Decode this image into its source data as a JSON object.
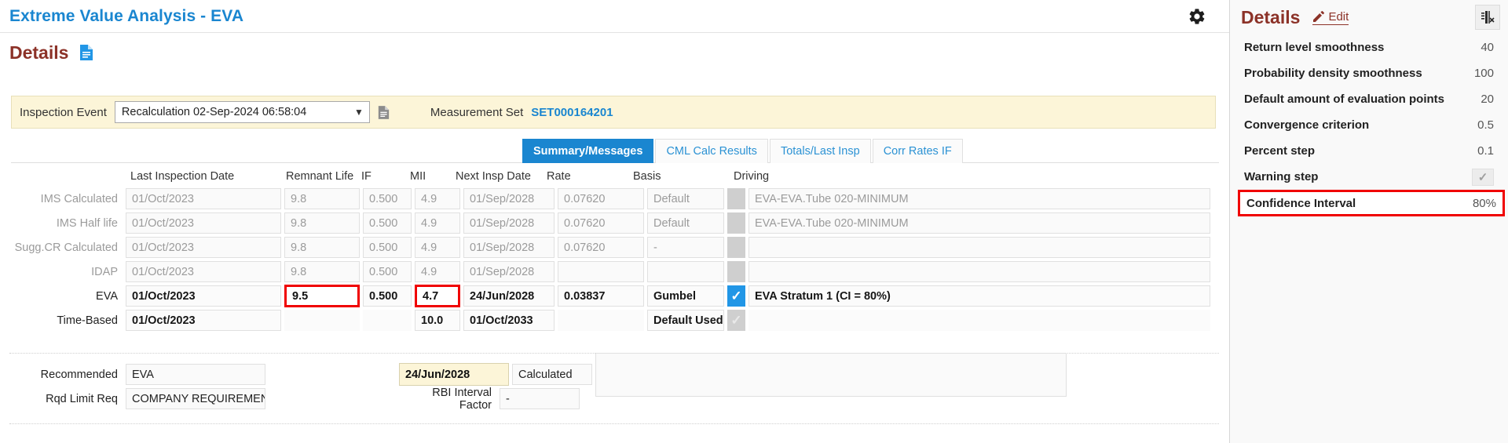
{
  "app": {
    "title": "Extreme Value Analysis - EVA",
    "gear_icon": "gear-icon"
  },
  "section": {
    "title": "Details",
    "doc_icon": "document-icon"
  },
  "eventbar": {
    "inspection_event_label": "Inspection Event",
    "inspection_event_value": "Recalculation 02-Sep-2024 06:58:04",
    "event_doc_icon": "document-icon",
    "measurement_set_label": "Measurement Set",
    "measurement_set_value": "SET000164201"
  },
  "tabs": [
    {
      "label": "Summary/Messages",
      "active": true
    },
    {
      "label": "CML Calc Results",
      "active": false
    },
    {
      "label": "Totals/Last Insp",
      "active": false
    },
    {
      "label": "Corr Rates IF",
      "active": false
    }
  ],
  "grid": {
    "headers": {
      "last_inspection_date": "Last Inspection Date",
      "remnant_life": "Remnant Life",
      "if": "IF",
      "mii": "MII",
      "next_insp_date": "Next Insp Date",
      "rate": "Rate",
      "basis": "Basis",
      "driving": "Driving"
    },
    "rows": [
      {
        "label": "IMS Calculated",
        "last_inspection_date": "01/Oct/2023",
        "remnant_life": "9.8",
        "if": "0.500",
        "mii": "4.9",
        "next_insp_date": "01/Sep/2028",
        "rate": "0.07620",
        "basis": "Default",
        "check": "empty",
        "driving": "EVA-EVA.Tube 020-MINIMUM"
      },
      {
        "label": "IMS Half life",
        "last_inspection_date": "01/Oct/2023",
        "remnant_life": "9.8",
        "if": "0.500",
        "mii": "4.9",
        "next_insp_date": "01/Sep/2028",
        "rate": "0.07620",
        "basis": "Default",
        "check": "empty",
        "driving": "EVA-EVA.Tube 020-MINIMUM"
      },
      {
        "label": "Sugg.CR Calculated",
        "last_inspection_date": "01/Oct/2023",
        "remnant_life": "9.8",
        "if": "0.500",
        "mii": "4.9",
        "next_insp_date": "01/Sep/2028",
        "rate": "0.07620",
        "basis": "-",
        "check": "empty",
        "driving": ""
      },
      {
        "label": "IDAP",
        "last_inspection_date": "01/Oct/2023",
        "remnant_life": "9.8",
        "if": "0.500",
        "mii": "4.9",
        "next_insp_date": "01/Sep/2028",
        "rate": "",
        "basis": "",
        "check": "empty",
        "driving": ""
      },
      {
        "label": "EVA",
        "last_inspection_date": "01/Oct/2023",
        "remnant_life": "9.5",
        "if": "0.500",
        "mii": "4.7",
        "next_insp_date": "24/Jun/2028",
        "rate": "0.03837",
        "basis": "Gumbel",
        "check": "on",
        "driving": "EVA Stratum 1 (CI = 80%)"
      },
      {
        "label": "Time-Based",
        "last_inspection_date": "01/Oct/2023",
        "remnant_life": "",
        "if": "",
        "mii": "10.0",
        "next_insp_date": "01/Oct/2033",
        "rate": "",
        "basis": "Default Used",
        "check": "off",
        "driving": ""
      }
    ]
  },
  "bottom": {
    "recommended_label": "Recommended",
    "recommended_value": "EVA",
    "recommended_next_insp": "24/Jun/2028",
    "recommended_basis": "Calculated",
    "recommended_driving": "",
    "rqd_limit_label": "Rqd Limit Req",
    "rqd_limit_value": "COMPANY REQUIREMENT",
    "rbi_interval_factor_label": "RBI Interval Factor",
    "rbi_interval_factor_value": "-"
  },
  "details_panel": {
    "title": "Details",
    "edit_label": "Edit",
    "edit_icon": "pencil-edit-icon",
    "panel_button_icon": "collapse-panel-icon",
    "rows": [
      {
        "key": "Return level smoothness",
        "value": "40",
        "type": "text",
        "highlight": false
      },
      {
        "key": "Probability density smoothness",
        "value": "100",
        "type": "text",
        "highlight": false
      },
      {
        "key": "Default amount of evaluation points",
        "value": "20",
        "type": "text",
        "highlight": false
      },
      {
        "key": "Convergence criterion",
        "value": "0.5",
        "type": "text",
        "highlight": false
      },
      {
        "key": "Percent step",
        "value": "0.1",
        "type": "text",
        "highlight": false
      },
      {
        "key": "Warning step",
        "value": "",
        "type": "checkbox",
        "highlight": false
      },
      {
        "key": "Confidence Interval",
        "value": "80%",
        "type": "text",
        "highlight": true
      }
    ]
  },
  "colors": {
    "accent_blue": "#1a86d0",
    "title_maroon": "#8c3228",
    "highlight_red": "#f00000",
    "event_yellow": "#fcf5d8",
    "check_blue": "#2196e6"
  }
}
